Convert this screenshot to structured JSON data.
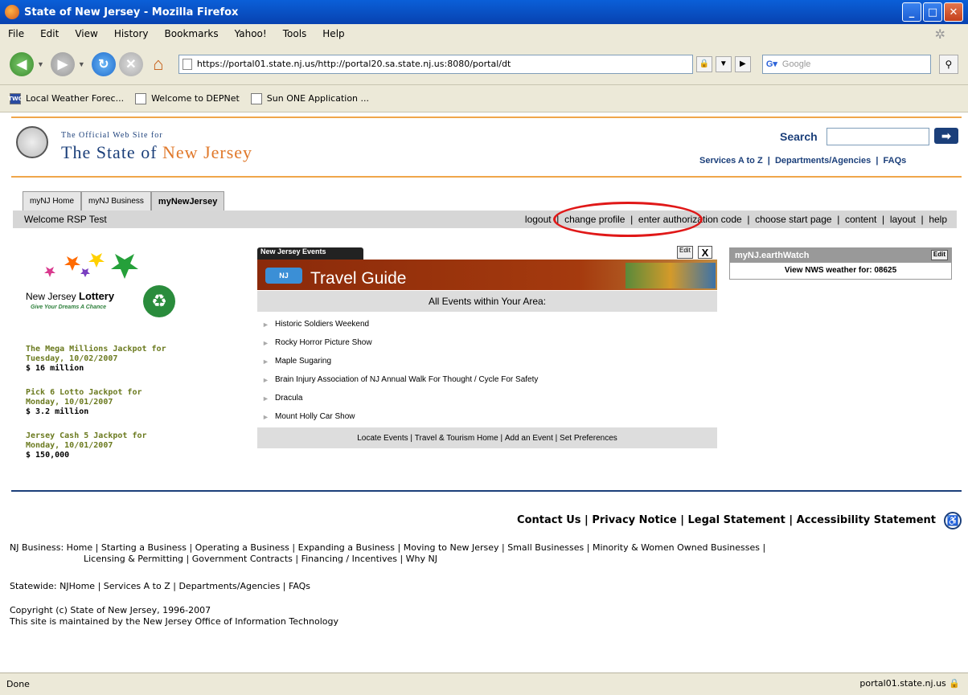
{
  "window": {
    "title": "State of New Jersey - Mozilla Firefox"
  },
  "menu": [
    "File",
    "Edit",
    "View",
    "History",
    "Bookmarks",
    "Yahoo!",
    "Tools",
    "Help"
  ],
  "address": {
    "url": "https://portal01.state.nj.us/http://portal20.sa.state.nj.us:8080/portal/dt",
    "search_placeholder": "Google"
  },
  "bookmarks": [
    "Local Weather Forec...",
    "Welcome to DEPNet",
    "Sun ONE Application ..."
  ],
  "site": {
    "logo_small": "The Official Web Site for",
    "logo_big_1": "The State of",
    "logo_big_2": "New Jersey",
    "search_label": "Search",
    "top_links": [
      "Services A to Z",
      "Departments/Agencies",
      "FAQs"
    ]
  },
  "tabs": [
    "myNJ Home",
    "myNJ Business",
    "myNewJersey"
  ],
  "welcome": "Welcome RSP Test",
  "user_links": [
    "logout",
    "change profile",
    "enter authorization code",
    "choose start page",
    "content",
    "layout",
    "help"
  ],
  "lottery": {
    "name_1": "New Jersey",
    "name_2": "Lottery",
    "tagline": "Give Your Dreams A Chance",
    "jackpots": [
      {
        "label_1": "The Mega Millions Jackpot for",
        "label_2": "Tuesday, 10/02/2007",
        "amount": "$ 16 million"
      },
      {
        "label_1": "Pick 6 Lotto Jackpot for",
        "label_2": "Monday, 10/01/2007",
        "amount": "$ 3.2 million"
      },
      {
        "label_1": "Jersey Cash 5 Jackpot for",
        "label_2": "Monday, 10/01/2007",
        "amount": "$ 150,000"
      }
    ]
  },
  "events": {
    "tab": "New Jersey Events",
    "edit": "Edit",
    "close": "X",
    "banner": "Travel Guide",
    "heading": "All Events within Your Area:",
    "items": [
      "Historic Soldiers Weekend",
      "Rocky Horror Picture Show",
      "Maple Sugaring",
      "Brain Injury Association of NJ Annual Walk For Thought / Cycle For Safety",
      "Dracula",
      "Mount Holly Car Show"
    ],
    "footer_links": [
      "Locate Events",
      "Travel & Tourism Home",
      "Add an Event",
      "Set Preferences"
    ]
  },
  "earthwatch": {
    "title": "myNJ.earthWatch",
    "edit": "Edit",
    "link": "View NWS weather for: 08625"
  },
  "footer": {
    "links": [
      "Contact Us",
      "Privacy Notice",
      "Legal Statement",
      "Accessibility Statement"
    ],
    "business_1": "NJ Business: Home | Starting a Business | Operating a Business | Expanding a Business | Moving to New Jersey | Small Businesses | Minority & Women Owned Businesses |",
    "business_2": "Licensing & Permitting | Government Contracts | Financing / Incentives | Why NJ",
    "statewide": "Statewide:   NJHome | Services A to Z | Departments/Agencies | FAQs",
    "copy_1": "Copyright (c) State of New Jersey, 1996-2007",
    "copy_2": "This site is maintained by the New Jersey Office of Information Technology"
  },
  "status": {
    "left": "Done",
    "right": "portal01.state.nj.us"
  }
}
